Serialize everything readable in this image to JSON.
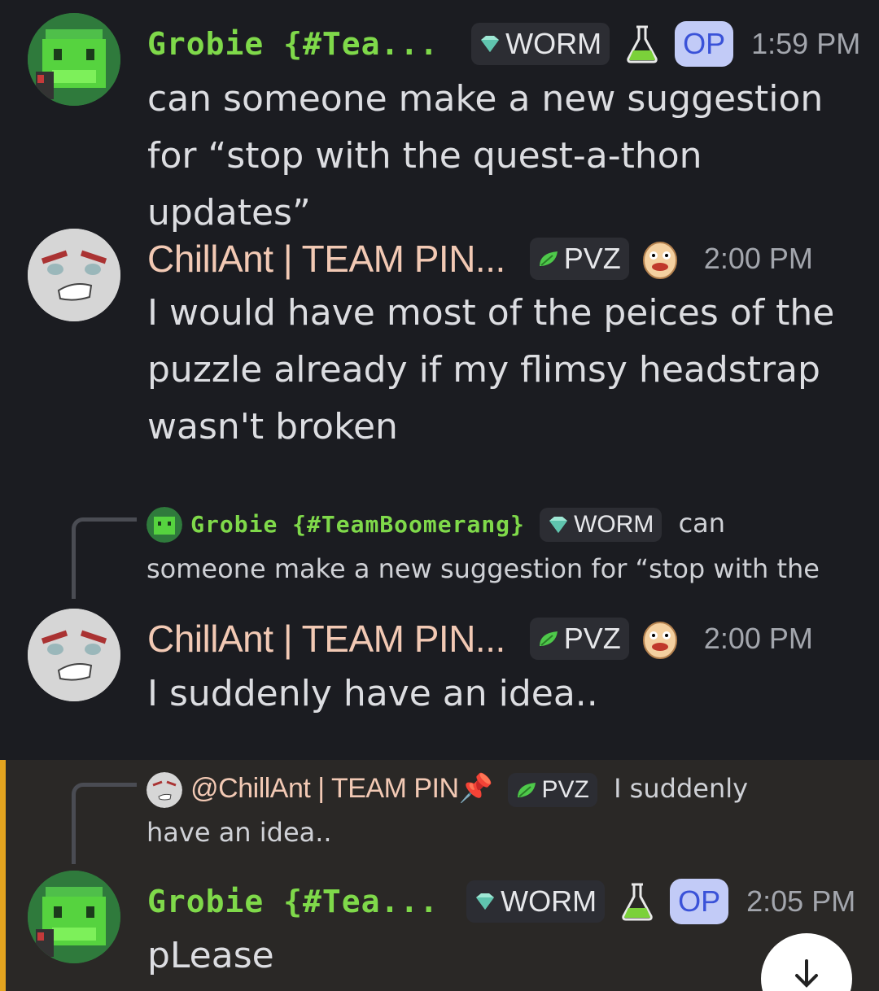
{
  "messages": [
    {
      "author": "Grobie {#Tea...",
      "tag": "WORM",
      "op": "OP",
      "time": "1:59 PM",
      "text": "can someone make a new suggestion for “stop with the quest-a-thon updates”"
    },
    {
      "author": "ChillAnt | TEAM PIN...",
      "tag": "PVZ",
      "time": "2:00 PM",
      "text": "I would have most of the peices of the puzzle already if my flimsy headstrap wasn't broken"
    },
    {
      "reply": {
        "author": "Grobie {#TeamBoomerang}",
        "tag": "WORM",
        "text_start": "can",
        "text_rest": "someone make a new suggestion for “stop with the"
      },
      "author": "ChillAnt | TEAM PIN...",
      "tag": "PVZ",
      "time": "2:00 PM",
      "text": "I suddenly have an idea.."
    },
    {
      "reply": {
        "author": "@ChillAnt | TEAM PIN📌",
        "tag": "PVZ",
        "text_start": "I suddenly",
        "text_rest": "have an idea.."
      },
      "author": "Grobie {#Tea...",
      "tag": "WORM",
      "op": "OP",
      "time": "2:05 PM",
      "text": "pLease"
    }
  ],
  "colors": {
    "background": "#1b1c21",
    "grobie_name": "#7fd94a",
    "chillant_name": "#f2c9b4",
    "op_badge": "#c2cbf7",
    "highlight_bar": "#e3a41f"
  },
  "icons": [
    "worm-gem-icon",
    "flask-icon",
    "leaf-icon",
    "potato-face-icon",
    "pushpin-icon",
    "arrow-down-icon"
  ]
}
